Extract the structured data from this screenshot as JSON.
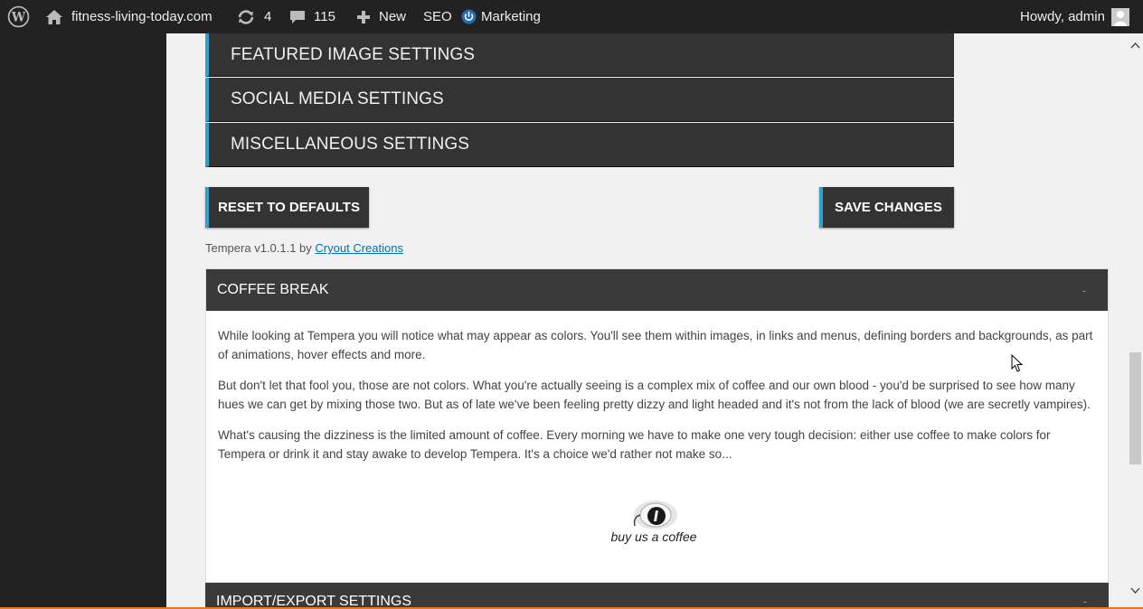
{
  "adminbar": {
    "site_name": "fitness-living-today.com",
    "updates_count": "4",
    "comments_count": "115",
    "new_label": "New",
    "seo_label": "SEO",
    "marketing_label": "Marketing",
    "greeting": "Howdy, admin"
  },
  "settings_sections": [
    "FEATURED IMAGE SETTINGS",
    "SOCIAL MEDIA SETTINGS",
    "MISCELLANEOUS SETTINGS"
  ],
  "buttons": {
    "reset": "RESET TO DEFAULTS",
    "save": "SAVE CHANGES"
  },
  "credit": {
    "prefix": "Tempera v1.0.1.1 by",
    "link": "Cryout Creations"
  },
  "coffee_panel": {
    "title": "COFFEE BREAK",
    "toggle": "-",
    "paragraphs": [
      "While looking at Tempera you will notice what may appear as colors. You'll see them within images, in links and menus, defining borders and backgrounds, as part of animations, hover effects and more.",
      "But don't let that fool you, those are not colors. What you're actually seeing is a complex mix of coffee and our own blood - you'd be surprised to see how many hues we can get by mixing those two. But as of late we've been feeling pretty dizzy and light headed and it's not from the lack of blood (we are secretly vampires).",
      "What's causing the dizziness is the limited amount of coffee. Every morning we have to make one very tough decision: either use coffee to make colors for Tempera or drink it and stay awake to develop Tempera. It's a choice we'd rather not make so..."
    ],
    "donate_label": "buy us  a coffee"
  },
  "import_export": {
    "title": "IMPORT/EXPORT SETTINGS",
    "toggle": "-"
  },
  "colors": {
    "accent": "#2ea2cc",
    "admin_bar": "#222222",
    "section_bar": "#333333"
  }
}
